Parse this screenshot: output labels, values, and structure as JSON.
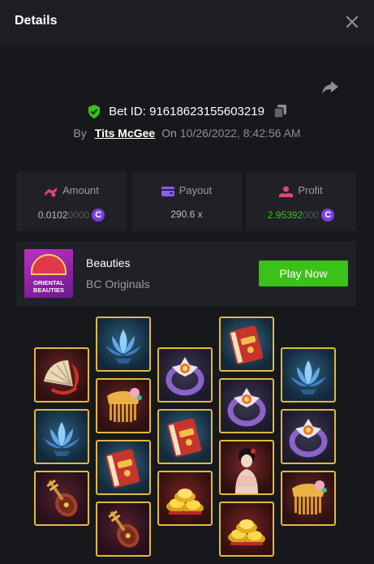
{
  "header": {
    "title": "Details",
    "close_icon": "close-icon"
  },
  "bet": {
    "id_text": "Bet ID: 91618623155603219",
    "by_label": "By",
    "user": "Tits McGee",
    "on_label": "On",
    "date": "10/26/2022, 8:42:56 AM"
  },
  "stats": {
    "amount": {
      "label": "Amount",
      "value_main": "0.0102",
      "value_dim": "0000",
      "currency_symbol": "C"
    },
    "payout": {
      "label": "Payout",
      "value": "290.6 x"
    },
    "profit": {
      "label": "Profit",
      "value_main": "2.95392",
      "value_dim": "000",
      "currency_symbol": "C"
    }
  },
  "game": {
    "name": "Beauties",
    "provider": "BC Originals",
    "thumb_line1": "ORIENTAL",
    "thumb_line2": "BEAUTIES",
    "play_label": "Play Now"
  },
  "reels": [
    [
      "fan",
      "lotus",
      "pipa"
    ],
    [
      "lotus",
      "comb",
      "book",
      "pipa"
    ],
    [
      "ring",
      "book",
      "gold"
    ],
    [
      "book",
      "ring",
      "lady",
      "gold"
    ],
    [
      "lotus",
      "ring",
      "comb"
    ]
  ],
  "colors": {
    "accent_green": "#3bc117",
    "tile_border": "#e2b93e",
    "coin_purple": "#7b3fe4",
    "background": "#17181b",
    "panel": "#202126"
  }
}
